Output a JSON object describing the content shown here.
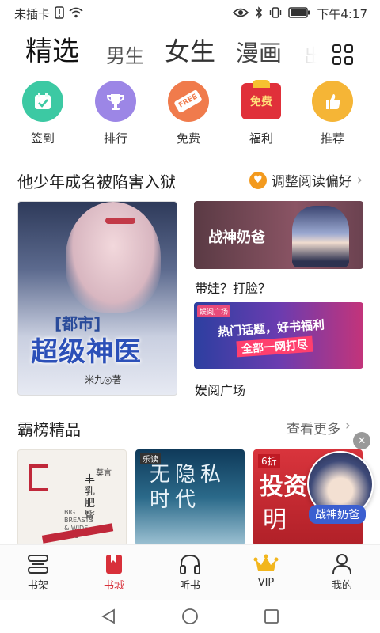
{
  "status": {
    "carrier": "未插卡",
    "time": "下午4:17",
    "icons": [
      "sim-alert-icon",
      "wifi-icon",
      "eye-icon",
      "bluetooth-icon",
      "vibrate-icon",
      "battery-icon"
    ]
  },
  "tabs": [
    {
      "label": "精选",
      "active": true
    },
    {
      "label": "男生"
    },
    {
      "label": "女生"
    },
    {
      "label": "漫画"
    },
    {
      "label": "出"
    }
  ],
  "quick": [
    {
      "label": "签到",
      "icon": "calendar-check-icon",
      "color": "#3cc9a3"
    },
    {
      "label": "排行",
      "icon": "trophy-icon",
      "color": "#9c86e6"
    },
    {
      "label": "免费",
      "icon": "free-tag-icon",
      "color": "#f07b4c",
      "badge": "FREE"
    },
    {
      "label": "福利",
      "icon": "gift-icon",
      "color": "#e0303a",
      "badge": "免费"
    },
    {
      "label": "推荐",
      "icon": "thumbs-up-icon",
      "color": "#f5b536"
    }
  ],
  "section1": {
    "title": "他少年成名被陷害入狱",
    "pref_label": "调整阅读偏好",
    "main_cover": {
      "tag": "[都市]",
      "title": "超级神医",
      "author": "米九◎著"
    },
    "banner1": {
      "text": "战神奶爸",
      "caption": "带娃？打脸？"
    },
    "banner2": {
      "badge": "娱阅广场",
      "line1": "热门话题，好书福利",
      "line2": "全部一网打尽",
      "caption": "娱阅广场"
    }
  },
  "section2": {
    "title": "霸榜精品",
    "more_label": "查看更多",
    "covers": [
      {
        "title": "丰乳肥臀",
        "sub": "BIG BREASTS & WIDE HIPS",
        "brand": "莫言"
      },
      {
        "title": "无隐私时代",
        "tag": "乐读"
      },
      {
        "title": "投资",
        "sub": "明",
        "tag": "6折"
      }
    ]
  },
  "float_ad": {
    "label": "战神奶爸"
  },
  "bottomnav": [
    {
      "label": "书架",
      "icon": "bookshelf-icon"
    },
    {
      "label": "书城",
      "icon": "bookstore-icon",
      "active": true
    },
    {
      "label": "听书",
      "icon": "headphones-icon"
    },
    {
      "label": "VIP",
      "icon": "crown-icon"
    },
    {
      "label": "我的",
      "icon": "user-icon"
    }
  ],
  "colors": {
    "accent": "#d8303a",
    "pref_heart": "#f39a1e"
  }
}
